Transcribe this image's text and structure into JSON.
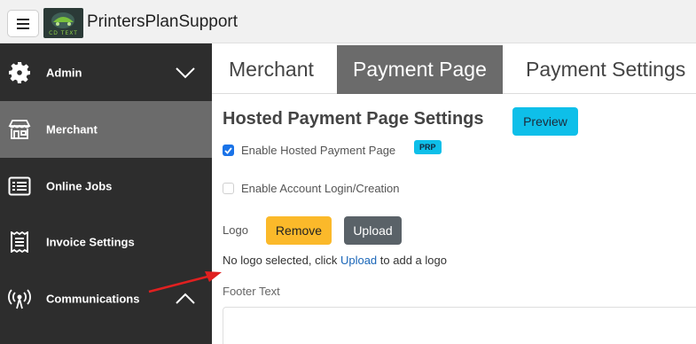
{
  "header": {
    "brand": "PrintersPlanSupport",
    "logo_text": "CD TEXT"
  },
  "sidebar": {
    "items": [
      {
        "label": "Admin",
        "icon": "gear-icon",
        "active": false,
        "chevron": "chevron-down-icon"
      },
      {
        "label": "Merchant",
        "icon": "storefront-icon",
        "active": true
      },
      {
        "label": "Online Jobs",
        "icon": "list-icon",
        "active": false
      },
      {
        "label": "Invoice Settings",
        "icon": "receipt-icon",
        "active": false
      },
      {
        "label": "Communications",
        "icon": "broadcast-icon",
        "active": false,
        "chevron": "chevron-up-icon"
      }
    ]
  },
  "tabs": [
    {
      "label": "Merchant",
      "active": false
    },
    {
      "label": "Payment Page",
      "active": true
    },
    {
      "label": "Payment Settings",
      "active": false
    }
  ],
  "content": {
    "title": "Hosted Payment Page Settings",
    "preview_label": "Preview",
    "enable_hosted_label": "Enable Hosted Payment Page",
    "enable_hosted_checked": true,
    "prp_badge": "PRP",
    "enable_account_label": "Enable Account Login/Creation",
    "enable_account_checked": false,
    "logo_label": "Logo",
    "remove_label": "Remove",
    "upload_label": "Upload",
    "no_logo_prefix": "No logo selected, click",
    "no_logo_link": "Upload",
    "no_logo_suffix": "to add a logo",
    "footer_label": "Footer Text",
    "footer_value": ""
  },
  "colors": {
    "sidebar_bg": "#2d2d2d",
    "active_bg": "#6b6b6b",
    "preview_btn": "#0ebfe9",
    "remove_btn": "#fbb92a",
    "upload_btn": "#5a6268",
    "link": "#1a66b8",
    "annotation_arrow": "#e02020"
  }
}
